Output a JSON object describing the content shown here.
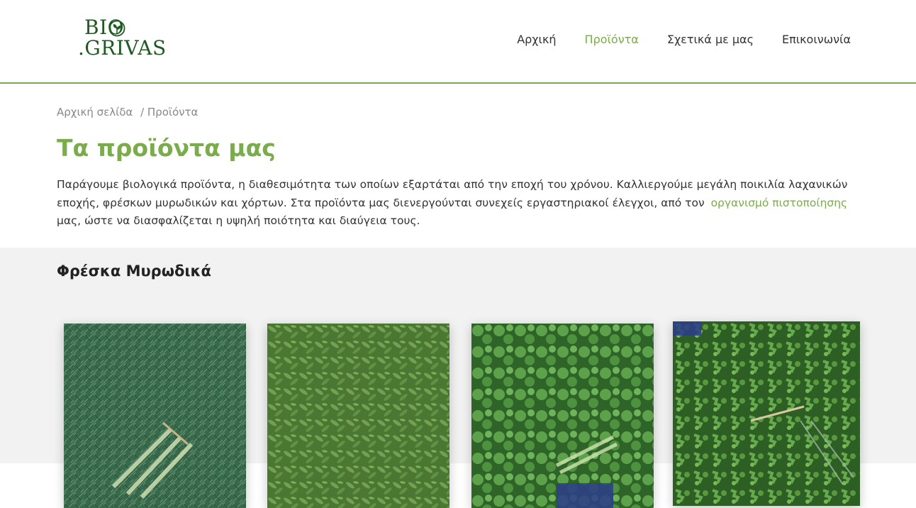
{
  "header": {
    "logo_line1": "BIO",
    "logo_line2": ".GRIVAS",
    "nav": [
      {
        "label": "Αρχική",
        "active": false
      },
      {
        "label": "Προϊόντα",
        "active": true
      },
      {
        "label": "Σχετικά με μας",
        "active": false
      },
      {
        "label": "Επικοινωνία",
        "active": false
      }
    ]
  },
  "breadcrumb": {
    "home": "Αρχική σελίδα",
    "separator": "/",
    "current": "Προϊόντα"
  },
  "page": {
    "title": "Τα προϊόντα μας",
    "intro_before": "Παράγουμε βιολογικά προϊόντα, η διαθεσιμότητα των οποίων εξαρτάται από την εποχή του χρόνου. Καλλιεργούμε μεγάλη ποικιλία λαχανικών εποχής, φρέσκων μυρωδικών και χόρτων. Στα προϊόντα μας διενεργούνται συνεχείς εργαστηριακοί έλεγχοι, από τον",
    "intro_link": "οργανισμό πιστοποίησης",
    "intro_after": "μας, ώστε να διασφαλίζεται η υψηλή ποιότητα και διαύγεια τους."
  },
  "section": {
    "title": "Φρέσκα Μυρωδικά"
  },
  "colors": {
    "accent": "#7aac4b",
    "logo": "#1f5a23",
    "section_bg": "#f2f2f2"
  }
}
